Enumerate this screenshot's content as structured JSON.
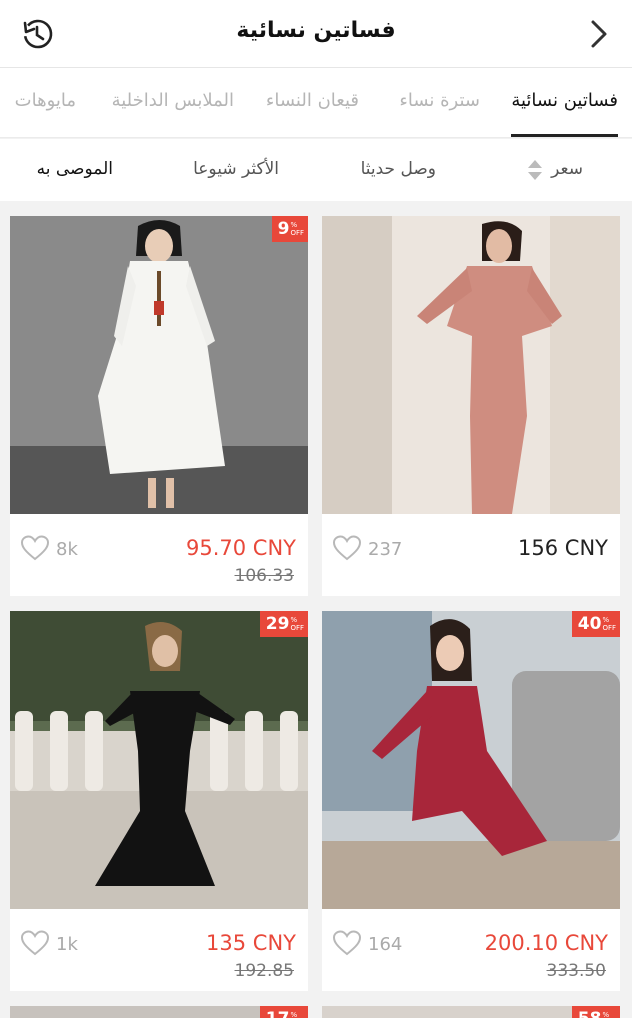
{
  "header": {
    "title": "فساتين نسائية",
    "back_icon": "history-back-icon",
    "forward_icon": "chevron-right-icon"
  },
  "tabs": [
    {
      "label": "فساتين نسائية",
      "active": true
    },
    {
      "label": "سترة نساء",
      "active": false
    },
    {
      "label": "قيعان النساء",
      "active": false
    },
    {
      "label": "الملابس الداخلية",
      "active": false
    },
    {
      "label": "مايوهات",
      "active": false
    }
  ],
  "sort": {
    "price": "سعر",
    "newest": "وصل حديثا",
    "popular": "الأكثر شيوعا",
    "recommended": "الموصى به"
  },
  "products": [
    {
      "badge": "9",
      "price": "95.70 CNY",
      "old_price": "106.33",
      "likes": "8k",
      "price_color": "#e8483a"
    },
    {
      "badge": "",
      "price": "156 CNY",
      "old_price": "",
      "likes": "237",
      "price_color": "#222222"
    },
    {
      "badge": "29",
      "price": "135 CNY",
      "old_price": "192.85",
      "likes": "1k",
      "price_color": "#e8483a"
    },
    {
      "badge": "40",
      "price": "200.10 CNY",
      "old_price": "333.50",
      "likes": "164",
      "price_color": "#e8483a"
    },
    {
      "badge": "17",
      "price": "",
      "old_price": "",
      "likes": "",
      "price_color": "#e8483a"
    },
    {
      "badge": "58",
      "price": "",
      "old_price": "",
      "likes": "",
      "price_color": "#e8483a"
    }
  ],
  "badge_suffix": {
    "percent": "%",
    "off": "OFF"
  },
  "colors": {
    "accent": "#e8483a",
    "text": "#111111",
    "muted": "#b5b5b5"
  }
}
